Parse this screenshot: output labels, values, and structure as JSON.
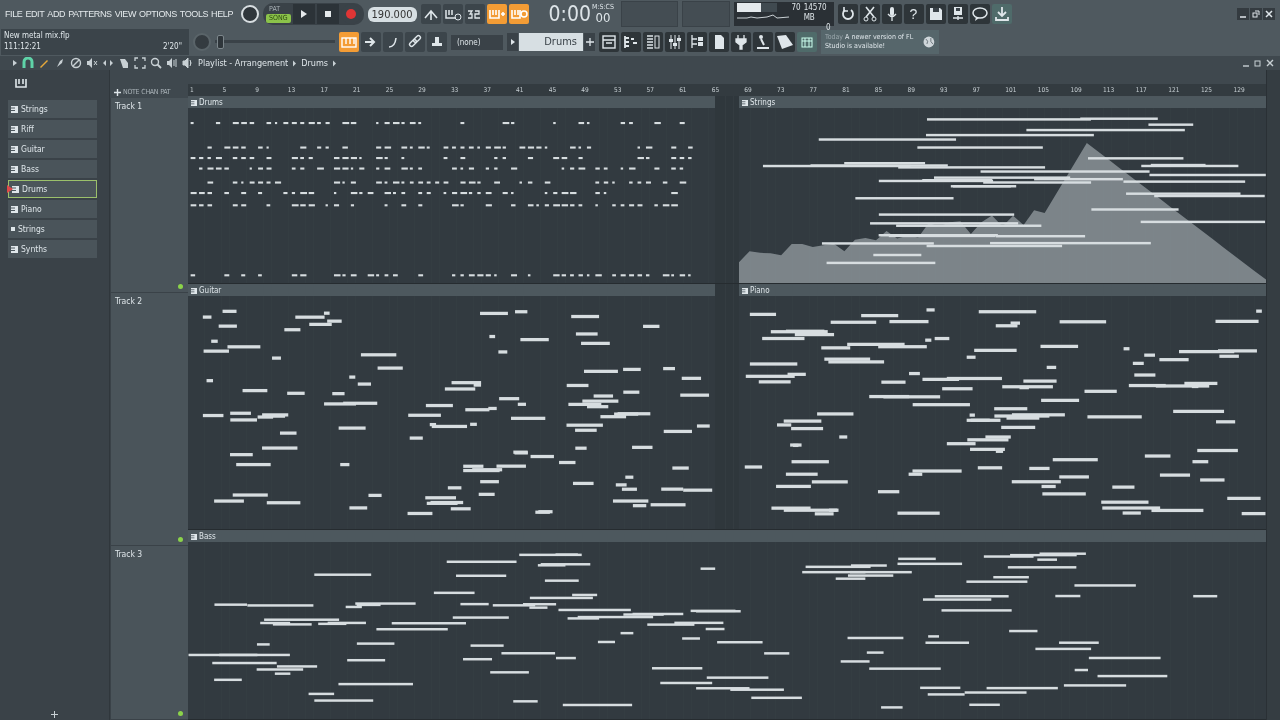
{
  "menu": [
    "FILE",
    "EDIT",
    "ADD",
    "PATTERNS",
    "VIEW",
    "OPTIONS",
    "TOOLS",
    "HELP"
  ],
  "project": {
    "filename": "New metal mix.flp",
    "position": "111:12:21",
    "duration": "2'20\""
  },
  "transport": {
    "pat_label": "PAT",
    "song_label": "SONG",
    "song_selected": true,
    "tempo": "190.000",
    "time": "0:00",
    "time_small": "00",
    "time_unit": "M:S:CS"
  },
  "record_toggles": [
    {
      "on": false
    },
    {
      "on": false
    },
    {
      "on": false
    },
    {
      "on": true
    },
    {
      "on": true
    }
  ],
  "tool_toggles": [
    {
      "on": true
    },
    {
      "on": false
    },
    {
      "on": false
    },
    {
      "on": false
    },
    {
      "on": false
    }
  ],
  "monitor": {
    "cpu": "70",
    "level": 0.62,
    "memory": "14570 MB",
    "polyphony": "0"
  },
  "help_label": "?",
  "pitch_slider": {
    "level": 0.02
  },
  "snap": "(none)",
  "pattern": "Drums",
  "hint": {
    "day": "Today",
    "message": "A newer version of FL Studio is available!"
  },
  "playlist": {
    "title": "Playlist - Arrangement",
    "pattern": "Drums"
  },
  "picker_tabs": [
    {
      "label": "NOTE"
    },
    {
      "label": "CHAN"
    },
    {
      "label": "PAT"
    }
  ],
  "pattern_list": [
    {
      "label": "Strings",
      "selected": false,
      "kind": "pattern"
    },
    {
      "label": "Riff",
      "selected": false,
      "kind": "pattern"
    },
    {
      "label": "Guitar",
      "selected": false,
      "kind": "pattern"
    },
    {
      "label": "Bass",
      "selected": false,
      "kind": "pattern"
    },
    {
      "label": "Drums",
      "selected": true,
      "kind": "pattern"
    },
    {
      "label": "Piano",
      "selected": false,
      "kind": "pattern"
    },
    {
      "label": "Strings",
      "selected": false,
      "kind": "audio"
    },
    {
      "label": "Synths",
      "selected": false,
      "kind": "pattern"
    }
  ],
  "ruler": [
    "1",
    "5",
    "9",
    "13",
    "17",
    "21",
    "25",
    "29",
    "33",
    "37",
    "41",
    "45",
    "49",
    "53",
    "57",
    "61",
    "65",
    "69",
    "73",
    "77",
    "81",
    "85",
    "89",
    "93",
    "97",
    "101",
    "105",
    "109",
    "113",
    "117",
    "121",
    "125",
    "129"
  ],
  "tracks": [
    {
      "name": "Track 1",
      "clips": [
        {
          "label": "Drums",
          "kind": "drums"
        },
        {
          "label": "Strings",
          "kind": "envelope"
        }
      ]
    },
    {
      "name": "Track 2",
      "clips": [
        {
          "label": "Guitar",
          "kind": "notes"
        },
        {
          "label": "Piano",
          "kind": "notes"
        }
      ]
    },
    {
      "name": "Track 3",
      "clips": [
        {
          "label": "Bass",
          "kind": "notes"
        }
      ]
    }
  ]
}
